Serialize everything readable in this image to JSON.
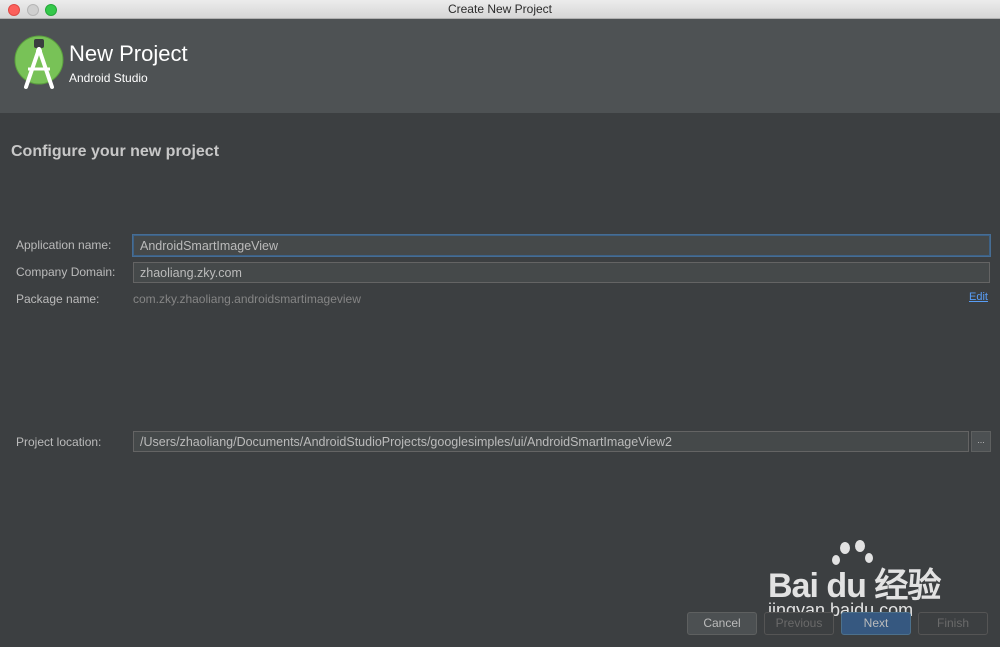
{
  "window": {
    "title": "Create New Project"
  },
  "header": {
    "title": "New Project",
    "subtitle": "Android Studio",
    "logo_icon": "android-studio-logo-icon"
  },
  "section_title": "Configure your new project",
  "form": {
    "app_name": {
      "label": "Application name:",
      "value": "AndroidSmartImageView"
    },
    "company_domain": {
      "label": "Company Domain:",
      "value": "zhaoliang.zky.com"
    },
    "package_name": {
      "label": "Package name:",
      "value": "com.zky.zhaoliang.androidsmartimageview",
      "edit_label": "Edit"
    },
    "project_location": {
      "label": "Project location:",
      "value": "/Users/zhaoliang/Documents/AndroidStudioProjects/googlesimples/ui/AndroidSmartImageView2",
      "browse_label": "..."
    }
  },
  "buttons": {
    "cancel": "Cancel",
    "previous": "Previous",
    "next": "Next",
    "finish": "Finish"
  },
  "watermark": {
    "brand": "Bai du 经验",
    "url": "jingyan.baidu.com"
  },
  "colors": {
    "background": "#3c3f41",
    "header": "#4e5254",
    "accent_link": "#589df6",
    "default_button": "#365880"
  }
}
